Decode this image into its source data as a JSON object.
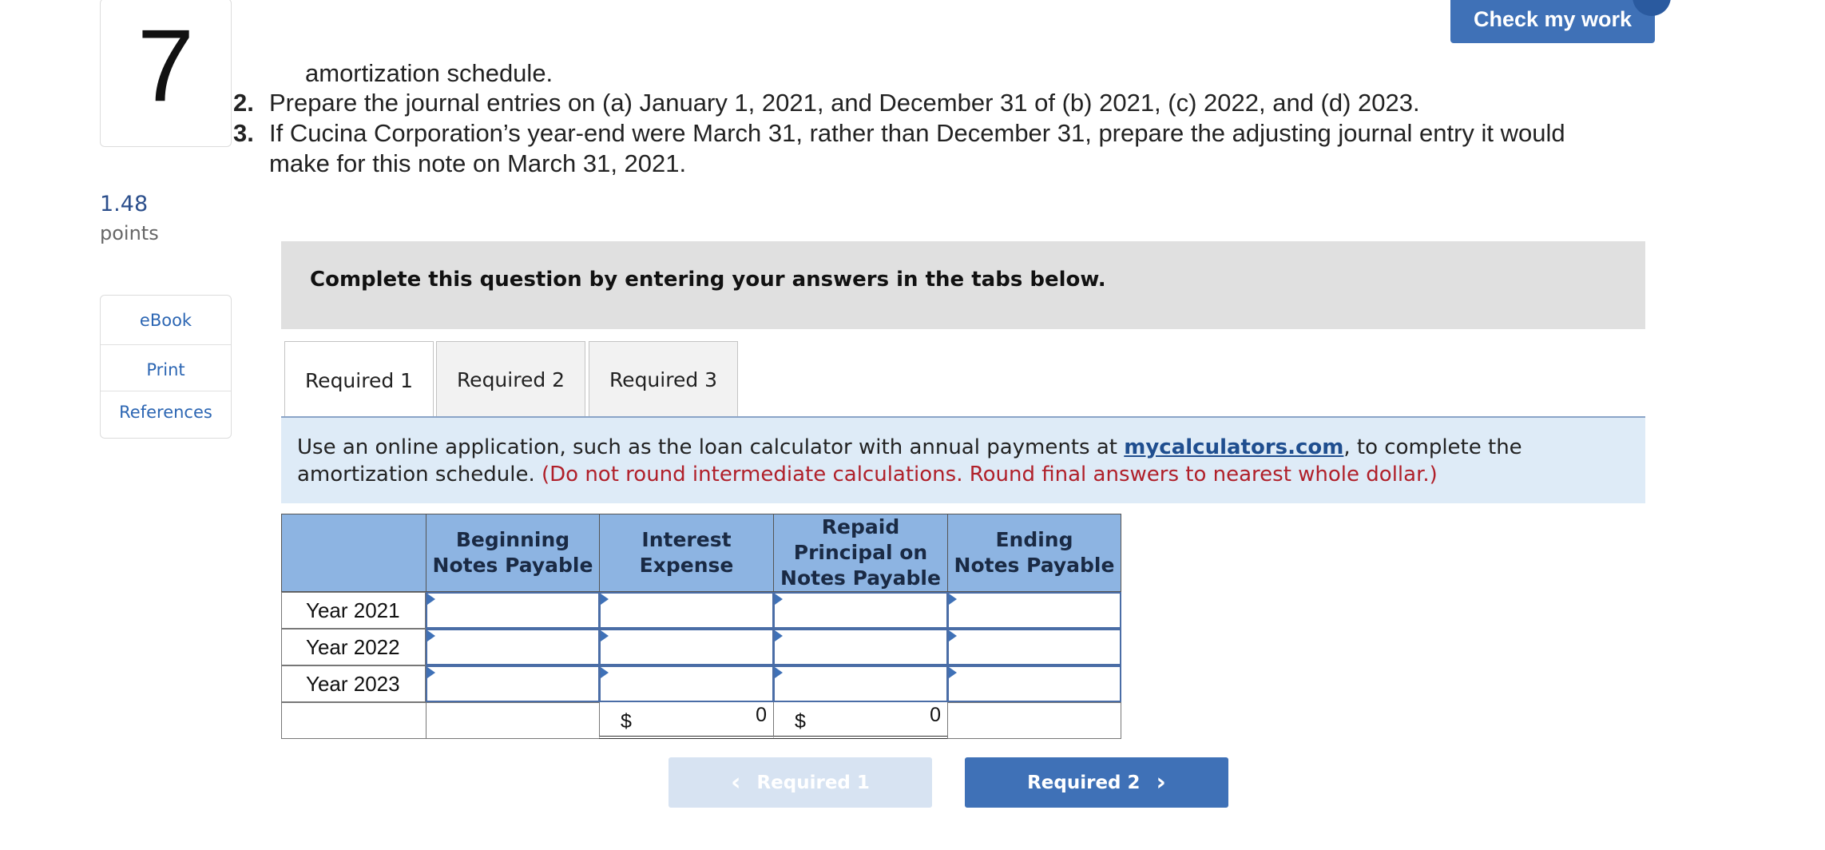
{
  "question": {
    "number": "7",
    "points_value": "1.48",
    "points_label": "points"
  },
  "side_links": {
    "ebook": "eBook",
    "print": "Print",
    "references": "References"
  },
  "check_button": "Check my work",
  "instructions": [
    {
      "num": "",
      "text": "amortization schedule."
    },
    {
      "num": "2.",
      "text": "Prepare the journal entries on (a) January 1, 2021, and December 31 of (b) 2021, (c) 2022, and (d) 2023."
    },
    {
      "num": "3.",
      "text": "If Cucina Corporation’s year-end were March 31, rather than December 31, prepare the adjusting journal entry it would"
    },
    {
      "num": "",
      "text": "make for this note on March 31, 2021."
    }
  ],
  "banner": "Complete this question by entering your answers in the tabs below.",
  "tabs": [
    "Required 1",
    "Required 2",
    "Required 3"
  ],
  "active_tab": "Required 1",
  "info": {
    "prefix": "Use an online application, such as the loan calculator with annual payments at ",
    "link": "mycalculators.com",
    "suffix": ", to complete the",
    "line2": "amortization schedule.",
    "note": "(Do not round intermediate calculations. Round final answers to nearest whole dollar.)"
  },
  "table": {
    "headers": [
      "Beginning Notes Payable",
      "Interest Expense",
      "Repaid Principal on Notes Payable",
      "Ending Notes Payable"
    ],
    "header_lines": [
      [
        "Beginning",
        "Notes Payable"
      ],
      [
        "Interest",
        "Expense"
      ],
      [
        "Repaid",
        "Principal on",
        "Notes Payable"
      ],
      [
        "Ending",
        "Notes Payable"
      ]
    ],
    "rows": [
      {
        "label": "Year 2021",
        "values": [
          "",
          "",
          "",
          ""
        ]
      },
      {
        "label": "Year 2022",
        "values": [
          "",
          "",
          "",
          ""
        ]
      },
      {
        "label": "Year 2023",
        "values": [
          "",
          "",
          "",
          ""
        ]
      }
    ],
    "totals": {
      "currency": "$",
      "interest_total": "0",
      "principal_total": "0"
    }
  },
  "nav": {
    "prev": "Required 1",
    "next": "Required 2"
  },
  "colors": {
    "accent": "#3f71b7",
    "header_fill": "#8db4e2",
    "info_fill": "#deebf7",
    "note_red": "#b0202a"
  }
}
